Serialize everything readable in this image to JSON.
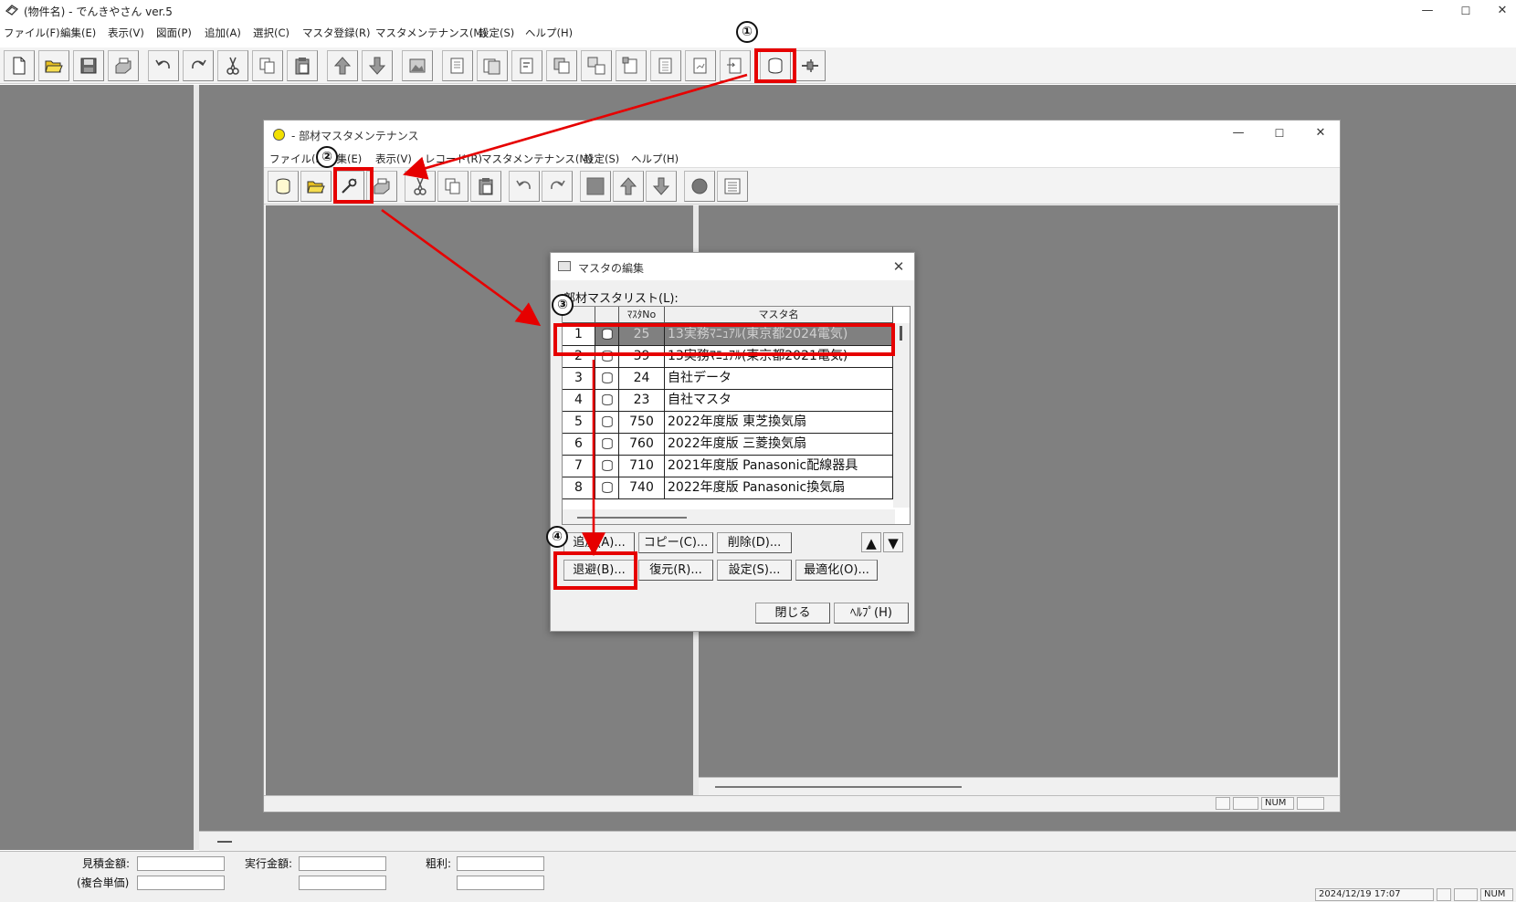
{
  "window": {
    "title": "(物件名) - でんきやさん ver.5",
    "minimize": "—",
    "maximize": "☐",
    "close": "✕"
  },
  "menubar": {
    "items": [
      "ファイル(F)",
      "編集(E)",
      "表示(V)",
      "図面(P)",
      "追加(A)",
      "選択(C)",
      "マスタ登録(R)",
      "マスタメンテナンス(M)",
      "設定(S)",
      "ヘルプ(H)"
    ]
  },
  "statusbar": {
    "estimate_label": "見積金額:",
    "execution_label": "実行金額:",
    "profit_label": "粗利:",
    "composite_label": "(複合単価)",
    "datetime": "2024/12/19 17:07",
    "num": "NUM"
  },
  "child_window": {
    "title": "- 部材マスタメンテナンス",
    "minimize": "—",
    "maximize": "☐",
    "close": "✕",
    "menu": [
      "ファイル(F)",
      "編集(E)",
      "表示(V)",
      "レコード(R)",
      "マスタメンテナンス(M)",
      "設定(S)",
      "ヘルプ(H)"
    ],
    "num": "NUM"
  },
  "dialog": {
    "title": "マスタの編集",
    "close": "✕",
    "list_label": "部材マスタリスト(L):",
    "columns": [
      "",
      "",
      "ﾏｽﾀNo",
      "マスタ名"
    ],
    "rows": [
      {
        "row": "1",
        "no": "25",
        "name": "13実務ﾏﾆｭｱﾙ(東京都2024電気)"
      },
      {
        "row": "2",
        "no": "39",
        "name": "13実務ﾏﾆｭｱﾙ(東京都2021電気)"
      },
      {
        "row": "3",
        "no": "24",
        "name": "自社データ"
      },
      {
        "row": "4",
        "no": "23",
        "name": "自社マスタ"
      },
      {
        "row": "5",
        "no": "750",
        "name": "2022年度版 東芝換気扇"
      },
      {
        "row": "6",
        "no": "760",
        "name": "2022年度版 三菱換気扇"
      },
      {
        "row": "7",
        "no": "710",
        "name": "2021年度版 Panasonic配線器具"
      },
      {
        "row": "8",
        "no": "740",
        "name": "2022年度版 Panasonic換気扇"
      }
    ],
    "buttons": {
      "add": "追加(A)...",
      "copy": "コピー(C)...",
      "delete": "削除(D)...",
      "up": "▲",
      "down": "▼",
      "backup": "退避(B)...",
      "restore": "復元(R)...",
      "settings": "設定(S)...",
      "optimize": "最適化(O)...",
      "close": "閉じる",
      "help": "ﾍﾙﾌﾟ(H)"
    }
  },
  "annotations": {
    "step1": "①",
    "step2": "②",
    "step3": "③",
    "step4": "④",
    "color": "#e60000"
  }
}
